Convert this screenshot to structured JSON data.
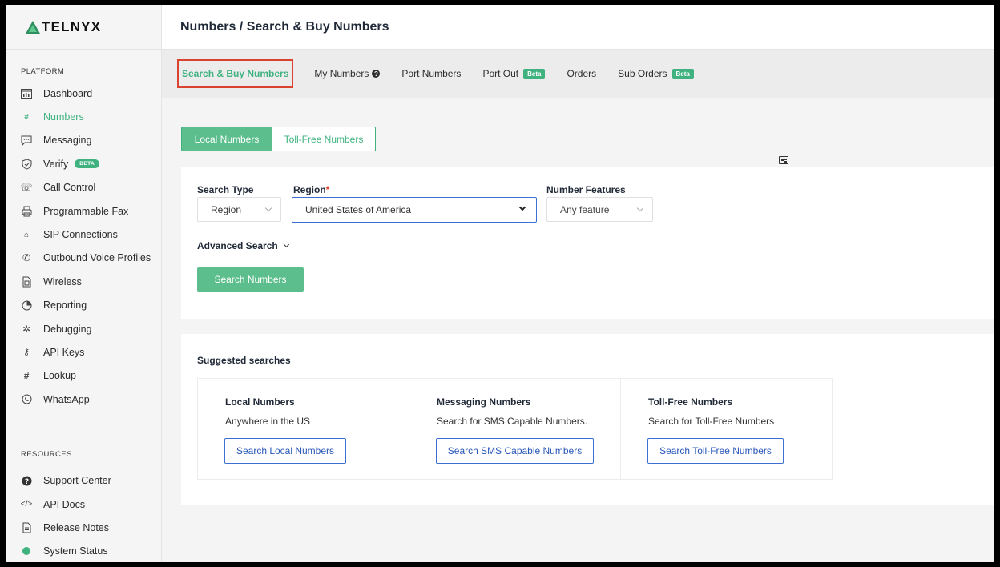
{
  "brand": {
    "name": "TELNYX",
    "accent": "#3fb27f"
  },
  "sidebar": {
    "platform_label": "PLATFORM",
    "platform_items": [
      {
        "label": "Dashboard",
        "icon": "dashboard-icon"
      },
      {
        "label": "Numbers",
        "icon": "numbers-icon",
        "active": true
      },
      {
        "label": "Messaging",
        "icon": "messaging-icon"
      },
      {
        "label": "Verify",
        "icon": "verify-shield-icon",
        "badge": "BETA"
      },
      {
        "label": "Call Control",
        "icon": "call-control-icon"
      },
      {
        "label": "Programmable Fax",
        "icon": "fax-icon"
      },
      {
        "label": "SIP Connections",
        "icon": "sip-icon"
      },
      {
        "label": "Outbound Voice Profiles",
        "icon": "outbound-voice-icon"
      },
      {
        "label": "Wireless",
        "icon": "sim-icon"
      },
      {
        "label": "Reporting",
        "icon": "pie-chart-icon"
      },
      {
        "label": "Debugging",
        "icon": "bug-icon"
      },
      {
        "label": "API Keys",
        "icon": "key-icon"
      },
      {
        "label": "Lookup",
        "icon": "hash-icon"
      },
      {
        "label": "WhatsApp",
        "icon": "whatsapp-icon"
      }
    ],
    "resources_label": "RESOURCES",
    "resource_items": [
      {
        "label": "Support Center",
        "icon": "help-icon"
      },
      {
        "label": "API Docs",
        "icon": "code-icon"
      },
      {
        "label": "Release Notes",
        "icon": "document-icon"
      },
      {
        "label": "System Status",
        "icon": "status-dot-icon"
      }
    ]
  },
  "header": {
    "title": "Numbers / Search & Buy Numbers"
  },
  "tabs": [
    {
      "label": "Search & Buy Numbers",
      "selected": true
    },
    {
      "label": "My Numbers"
    },
    {
      "label": "Port Numbers"
    },
    {
      "label": "Port Out",
      "tag": "Beta"
    },
    {
      "label": "Orders"
    },
    {
      "label": "Sub Orders",
      "tag": "Beta"
    }
  ],
  "segmented": {
    "local": "Local Numbers",
    "tollfree": "Toll-Free Numbers"
  },
  "search": {
    "search_type_label": "Search Type",
    "search_type_value": "Region",
    "region_label": "Region",
    "region_required_mark": "*",
    "region_value": "United States of America",
    "features_label": "Number Features",
    "features_value": "Any feature",
    "advanced_label": "Advanced Search",
    "submit_label": "Search Numbers"
  },
  "suggested": {
    "title": "Suggested searches",
    "items": [
      {
        "heading": "Local Numbers",
        "sub": "Anywhere in the US",
        "button": "Search Local Numbers"
      },
      {
        "heading": "Messaging Numbers",
        "sub": "Search for SMS Capable Numbers.",
        "button": "Search SMS Capable Numbers"
      },
      {
        "heading": "Toll-Free Numbers",
        "sub": "Search for Toll-Free Numbers",
        "button": "Search Toll-Free Numbers"
      }
    ]
  }
}
